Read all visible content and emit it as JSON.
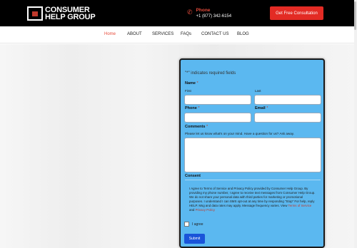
{
  "header": {
    "logo_line1": "CONSUMER",
    "logo_line2": "HELP GROUP",
    "phone_label": "Phone",
    "phone_number": "+1 (877) 342-6154",
    "cta_label": "Get Free Consultation",
    "accent_color": "#e32b24"
  },
  "nav": {
    "items": [
      "Home",
      "ABOUT",
      "SERVICES",
      "FAQs",
      "CONTACT US",
      "BLOG"
    ],
    "active": "Home"
  },
  "form": {
    "required_note": "\"*\" indicates required fields",
    "name_label": "Name",
    "first_label": "First",
    "last_label": "Last",
    "phone_label": "Phone",
    "email_label": "Email",
    "comments_label": "Comments",
    "comments_desc": "Please let us know what's on your mind. Have a question for us? Ask away.",
    "consent_label": "Consent",
    "consent_text": "I Agree to Terms of Service and Privacy Policy provided by Consumer Help Group. By providing my phone number, I agree to receive text messages from Consumer Help Group. We do not share your personal data with third parties for marketing or promotional purposes. I understand I can SMS opt-out at any time by responding \"Stop\" For help, reply HELP. Msg and data rates may apply. Message frequency varies. View",
    "terms_link": "Terms of Service",
    "and_word": "and",
    "privacy_link": "Privacy Policy",
    "agree_label": "I agree",
    "submit_label": "Submit",
    "panel_color": "#5bb8f0"
  }
}
